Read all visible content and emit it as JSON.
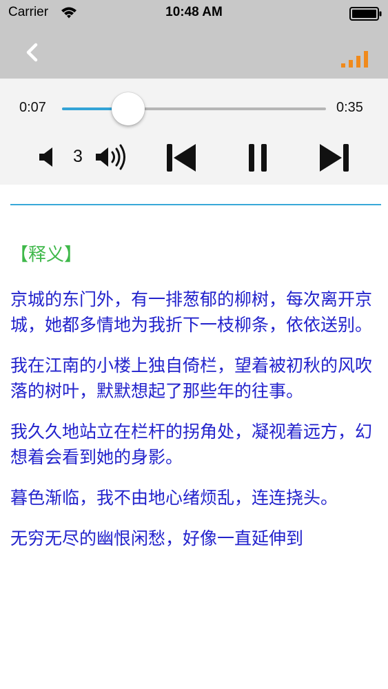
{
  "status_bar": {
    "carrier": "Carrier",
    "time": "10:48 AM"
  },
  "nav": {
    "back_icon": "chevron-left-icon",
    "right_icon": "signal-bars-icon",
    "accent_color": "#f08a1c"
  },
  "player": {
    "current_time": "0:07",
    "total_time": "0:35",
    "progress_fraction": 0.25,
    "volume_level": "3",
    "track_color": "#33a3d6",
    "icons": [
      "volume-down-icon",
      "volume-up-icon",
      "previous-track-icon",
      "pause-icon",
      "next-track-icon"
    ]
  },
  "content": {
    "section_label": "【释义】",
    "label_color": "#3fb84a",
    "text_color": "#2222cc",
    "paragraphs": [
      "京城的东门外，有一排葱郁的柳树，每次离开京城，她都多情地为我折下一枝柳条，依依送别。",
      "我在江南的小楼上独自倚栏，望着被初秋的风吹落的树叶，默默想起了那些年的往事。",
      "我久久地站立在栏杆的拐角处，凝视着远方，幻想着会看到她的身影。",
      "暮色渐临，我不由地心绪烦乱，连连挠头。",
      "无穷无尽的幽恨闲愁，好像一直延伸到"
    ]
  }
}
